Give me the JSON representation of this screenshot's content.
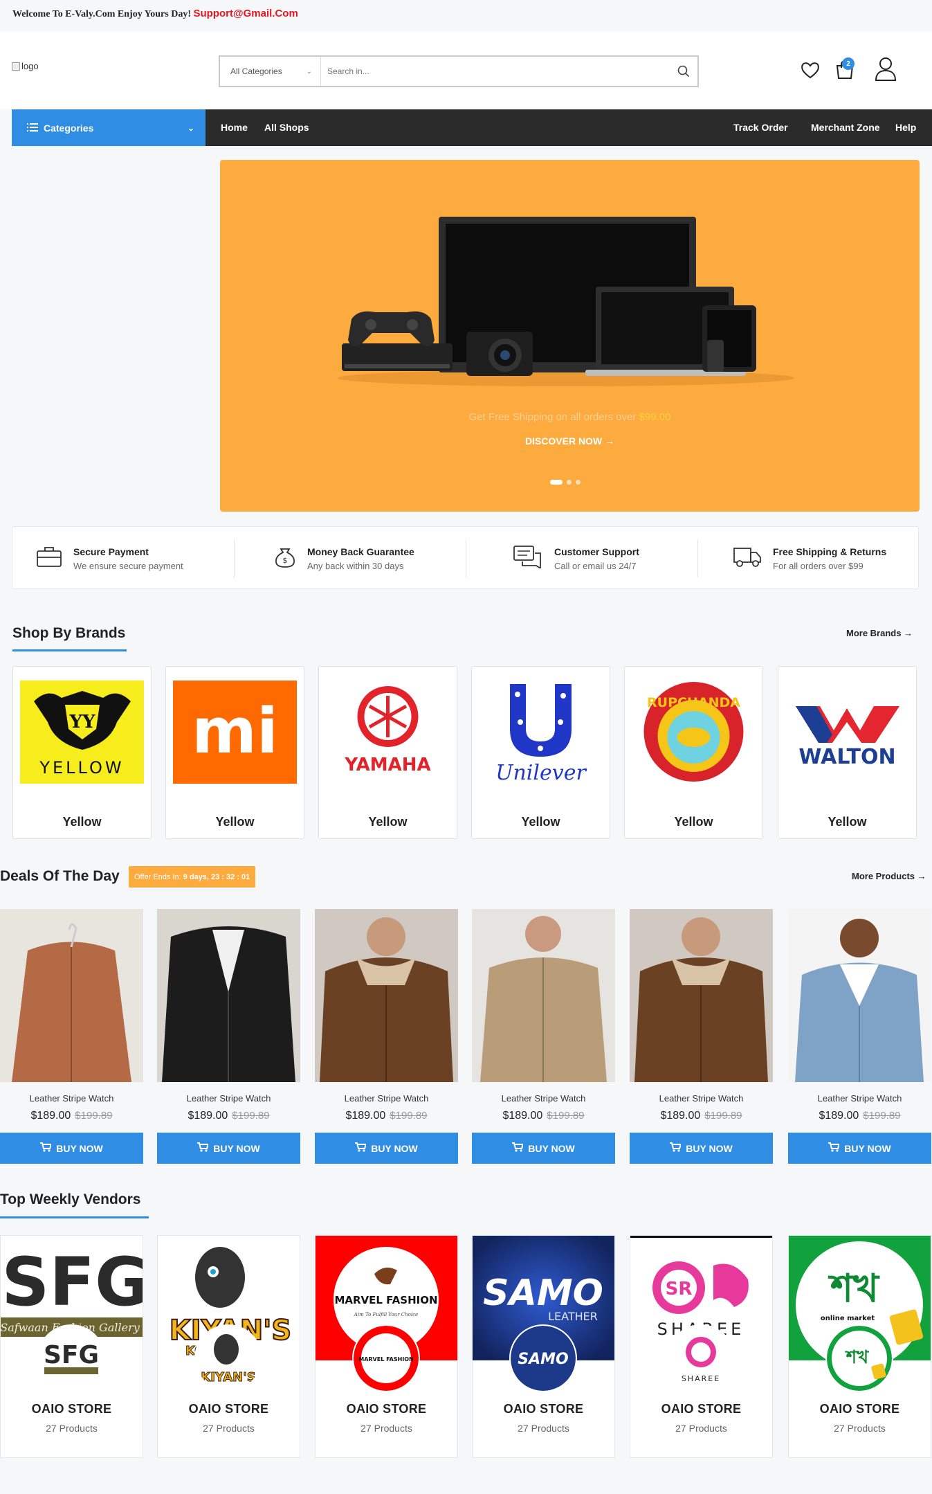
{
  "topbar": {
    "welcome": "Welcome To E-Valy.Com Enjoy Yours Day!",
    "email": "Support@Gmail.Com"
  },
  "header": {
    "logo_alt": "logo",
    "category_select": "All Categories",
    "search_placeholder": "Search in...",
    "cart_count": "2"
  },
  "nav": {
    "categories_label": "Categories",
    "links": [
      "Home",
      "All Shops"
    ],
    "right_links": [
      "Track Order",
      "Merchant Zone",
      "Help"
    ]
  },
  "banner": {
    "shipping_text": "Get Free Shipping on all orders over",
    "shipping_price": "$99.00",
    "cta": "DISCOVER NOW"
  },
  "features": [
    {
      "title": "Secure Payment",
      "subtitle": "We ensure secure payment",
      "icon": "briefcase-icon"
    },
    {
      "title": "Money Back Guarantee",
      "subtitle": "Any back within 30 days",
      "icon": "money-bag-icon"
    },
    {
      "title": "Customer Support",
      "subtitle": "Call or email us 24/7",
      "icon": "chat-icon"
    },
    {
      "title": "Free Shipping & Returns",
      "subtitle": "For all orders over $99",
      "icon": "truck-icon"
    }
  ],
  "brands": {
    "title": "Shop By Brands",
    "more": "More Brands",
    "items": [
      {
        "name": "Yellow",
        "logo_text": "YELLOW"
      },
      {
        "name": "Yellow",
        "logo_text": "mi"
      },
      {
        "name": "Yellow",
        "logo_text": "YAMAHA"
      },
      {
        "name": "Yellow",
        "logo_text": "Unilever"
      },
      {
        "name": "Yellow",
        "logo_text": "RUPCHANDA"
      },
      {
        "name": "Yellow",
        "logo_text": "WALTON"
      }
    ]
  },
  "deals": {
    "title": "Deals Of The Day",
    "offer_label": "Offer Ends In:",
    "offer_time": "9 days, 23 : 32 : 01",
    "more": "More Products",
    "buy_label": "BUY NOW",
    "products": [
      {
        "name": "Leather Stripe Watch",
        "price": "$189.00",
        "old_price": "$199.89",
        "jacket": "#b46a45"
      },
      {
        "name": "Leather Stripe Watch",
        "price": "$189.00",
        "old_price": "$199.89",
        "jacket": "#1c1c1c"
      },
      {
        "name": "Leather Stripe Watch",
        "price": "$189.00",
        "old_price": "$199.89",
        "jacket": "#6b4124"
      },
      {
        "name": "Leather Stripe Watch",
        "price": "$189.00",
        "old_price": "$199.89",
        "jacket": "#b99c78"
      },
      {
        "name": "Leather Stripe Watch",
        "price": "$189.00",
        "old_price": "$199.89",
        "jacket": "#6b4124"
      },
      {
        "name": "Leather Stripe Watch",
        "price": "$189.00",
        "old_price": "$199.89",
        "jacket": "#7fa3c6"
      }
    ]
  },
  "vendors": {
    "title": "Top Weekly Vendors",
    "items": [
      {
        "name": "OAIO STORE",
        "count": "27 Products",
        "logo_text": "SFG",
        "logo_sub": "Safwaan Fashion Gallery"
      },
      {
        "name": "OAIO STORE",
        "count": "27 Products",
        "logo_text": "KIYAN'S",
        "logo_sub": "KO"
      },
      {
        "name": "OAIO STORE",
        "count": "27 Products",
        "logo_text": "MARVEL FASHION",
        "logo_sub": "Aim To Fulfill Your Choice"
      },
      {
        "name": "OAIO STORE",
        "count": "27 Products",
        "logo_text": "SAMO",
        "logo_sub": "LEATHER"
      },
      {
        "name": "OAIO STORE",
        "count": "27 Products",
        "logo_text": "SHAREE",
        "logo_sub": "SR"
      },
      {
        "name": "OAIO STORE",
        "count": "27 Products",
        "logo_text": "শখ",
        "logo_sub": "online market"
      }
    ]
  },
  "colors": {
    "accent": "#2f8de4",
    "banner": "#fdab3f",
    "nav": "#2b2b2b"
  }
}
